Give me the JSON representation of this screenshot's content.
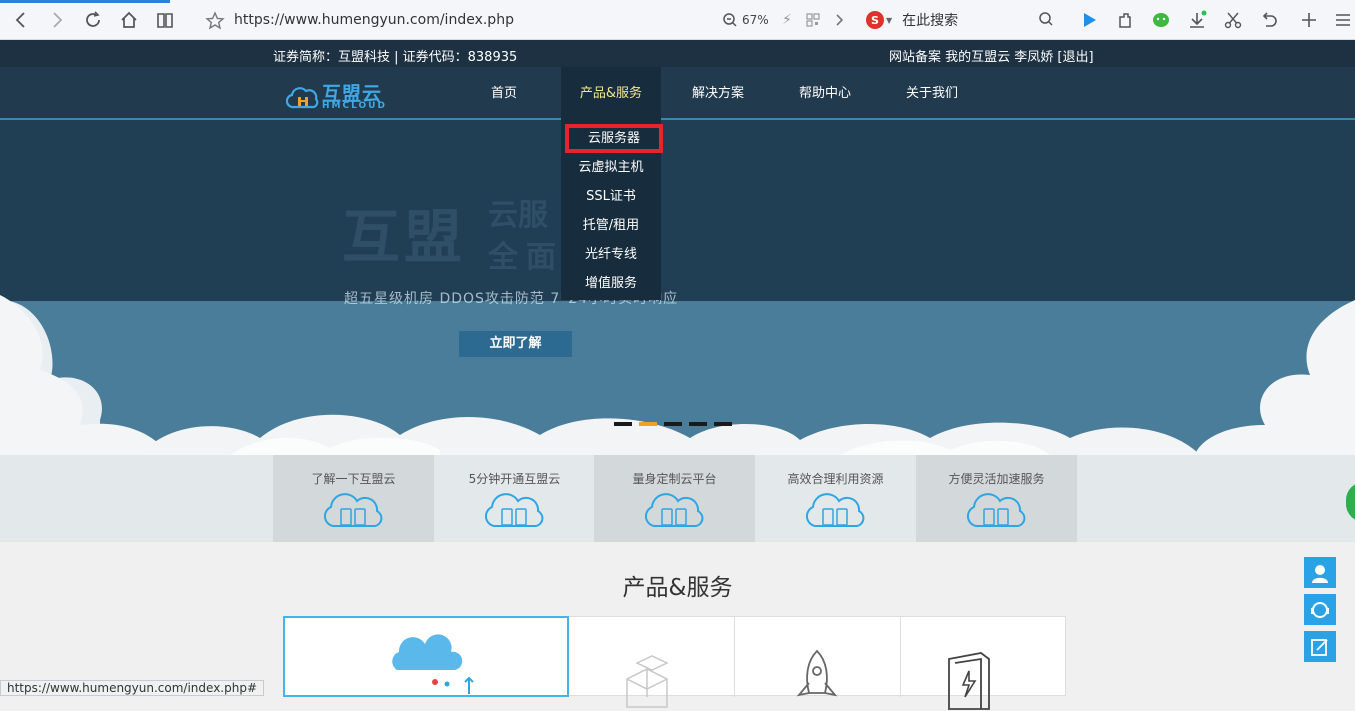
{
  "browser": {
    "url": "https://www.humengyun.com/index.php",
    "zoom": "67%",
    "search_placeholder": "在此搜索",
    "status_url": "https://www.humengyun.com/index.php#"
  },
  "topbar": {
    "left_text": "证券简称：互盟科技 | 证券代码：838935",
    "right_text": "网站备案 我的互盟云 李凤娇 [退出]"
  },
  "logo": {
    "cn": "互盟云",
    "en": "HMCLOUD"
  },
  "nav": {
    "items": [
      {
        "label": "首页"
      },
      {
        "label": "产品&服务"
      },
      {
        "label": "解决方案"
      },
      {
        "label": "帮助中心"
      },
      {
        "label": "关于我们"
      }
    ]
  },
  "dropdown": {
    "items": [
      {
        "label": "云服务器"
      },
      {
        "label": "云虚拟主机"
      },
      {
        "label": "SSL证书"
      },
      {
        "label": "托管/租用"
      },
      {
        "label": "光纤专线"
      },
      {
        "label": "增值服务"
      }
    ]
  },
  "banner": {
    "title_big": "互盟",
    "title_right_top": "云服",
    "title_right_bottom": "全面 案",
    "subtitle": "超五星级机房 DDOS攻击防范  7*24小时实时响应",
    "cta": "立即了解",
    "slide_count": 5,
    "active_slide": 2
  },
  "features": [
    {
      "label": "了解一下互盟云"
    },
    {
      "label": "5分钟开通互盟云"
    },
    {
      "label": "量身定制云平台"
    },
    {
      "label": "高效合理利用资源"
    },
    {
      "label": "方便灵活加速服务"
    }
  ],
  "products": {
    "title": "产品&服务"
  },
  "colors": {
    "topbar": "#1d3142",
    "nav": "#213a4d",
    "nav_active_text": "#f3e88a",
    "highlight_box": "#e5242b",
    "accent": "#29a3e6",
    "slide_active": "#f0a12c"
  }
}
